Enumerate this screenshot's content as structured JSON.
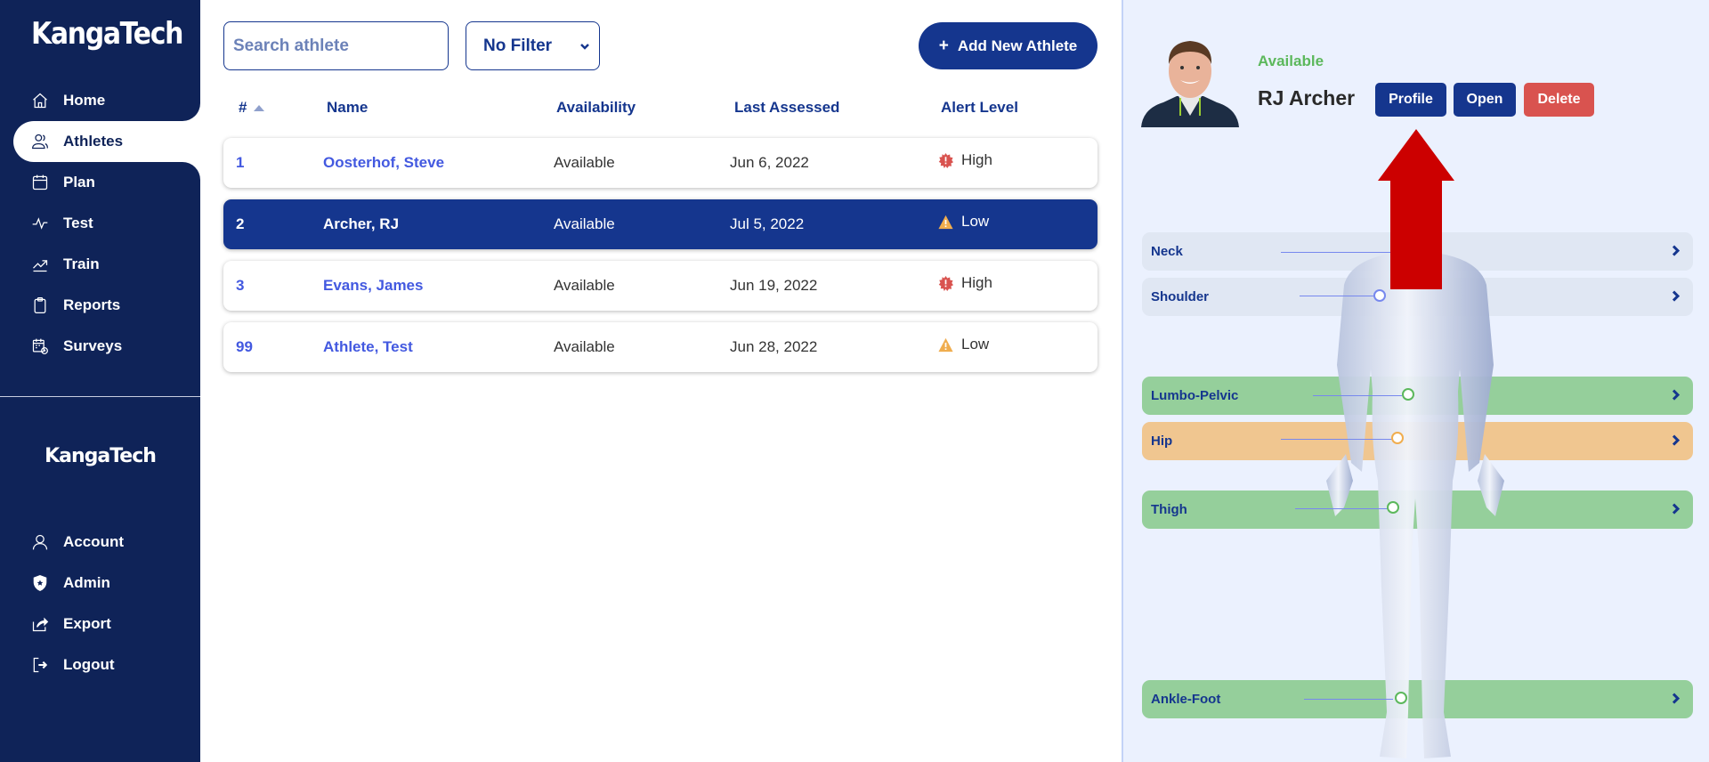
{
  "sidebar": {
    "brand": "KangaTech",
    "nav": [
      {
        "label": "Home",
        "icon": "home-icon"
      },
      {
        "label": "Athletes",
        "icon": "users-icon",
        "active": true
      },
      {
        "label": "Plan",
        "icon": "calendar-icon"
      },
      {
        "label": "Test",
        "icon": "pulse-icon"
      },
      {
        "label": "Train",
        "icon": "trending-up-icon"
      },
      {
        "label": "Reports",
        "icon": "clipboard-icon"
      },
      {
        "label": "Surveys",
        "icon": "calendar-clock-icon"
      }
    ],
    "brand_secondary": "KangaTech",
    "account_nav": [
      {
        "label": "Account",
        "icon": "user-icon"
      },
      {
        "label": "Admin",
        "icon": "shield-star-icon"
      },
      {
        "label": "Export",
        "icon": "share-icon"
      },
      {
        "label": "Logout",
        "icon": "logout-icon"
      }
    ]
  },
  "toolbar": {
    "search_placeholder": "Search athlete",
    "search_value": "",
    "filter_selected": "No Filter",
    "add_button_icon": "+",
    "add_button_label": "Add New Athlete"
  },
  "table": {
    "columns": [
      "#",
      "Name",
      "Availability",
      "Last Assessed",
      "Alert Level"
    ],
    "sort_column": "#",
    "sort_direction": "ascending",
    "rows": [
      {
        "num": "1",
        "name": "Oosterhof, Steve",
        "availability": "Available",
        "last_assessed": "Jun 6, 2022",
        "alert": "High",
        "alert_icon": "alert-burst-icon"
      },
      {
        "num": "2",
        "name": "Archer, RJ",
        "availability": "Available",
        "last_assessed": "Jul 5, 2022",
        "alert": "Low",
        "alert_icon": "warning-triangle-icon",
        "selected": true
      },
      {
        "num": "3",
        "name": "Evans, James",
        "availability": "Available",
        "last_assessed": "Jun 19, 2022",
        "alert": "High",
        "alert_icon": "alert-burst-icon"
      },
      {
        "num": "99",
        "name": "Athlete, Test",
        "availability": "Available",
        "last_assessed": "Jun 28, 2022",
        "alert": "Low",
        "alert_icon": "warning-triangle-icon"
      }
    ]
  },
  "detail": {
    "status": "Available",
    "name": "RJ Archer",
    "buttons": {
      "profile": "Profile",
      "open": "Open",
      "delete": "Delete"
    },
    "regions": [
      {
        "label": "Neck",
        "state": "neutral"
      },
      {
        "label": "Shoulder",
        "state": "neutral"
      },
      {
        "label": "Lumbo-Pelvic",
        "state": "green"
      },
      {
        "label": "Hip",
        "state": "orange"
      },
      {
        "label": "Thigh",
        "state": "green"
      },
      {
        "label": "Ankle-Foot",
        "state": "green"
      }
    ]
  },
  "colors": {
    "sidebar_bg": "#0f2358",
    "primary": "#15368e",
    "link": "#4359e0",
    "available": "#5cb85c",
    "delete": "#d9534f",
    "region_green": "#95cf9b",
    "region_orange": "#f0c690",
    "region_neutral": "#e0e7f3",
    "alert_high": "#d9534f",
    "alert_low": "#f0ad4e",
    "annotation_arrow": "#cc0000"
  }
}
